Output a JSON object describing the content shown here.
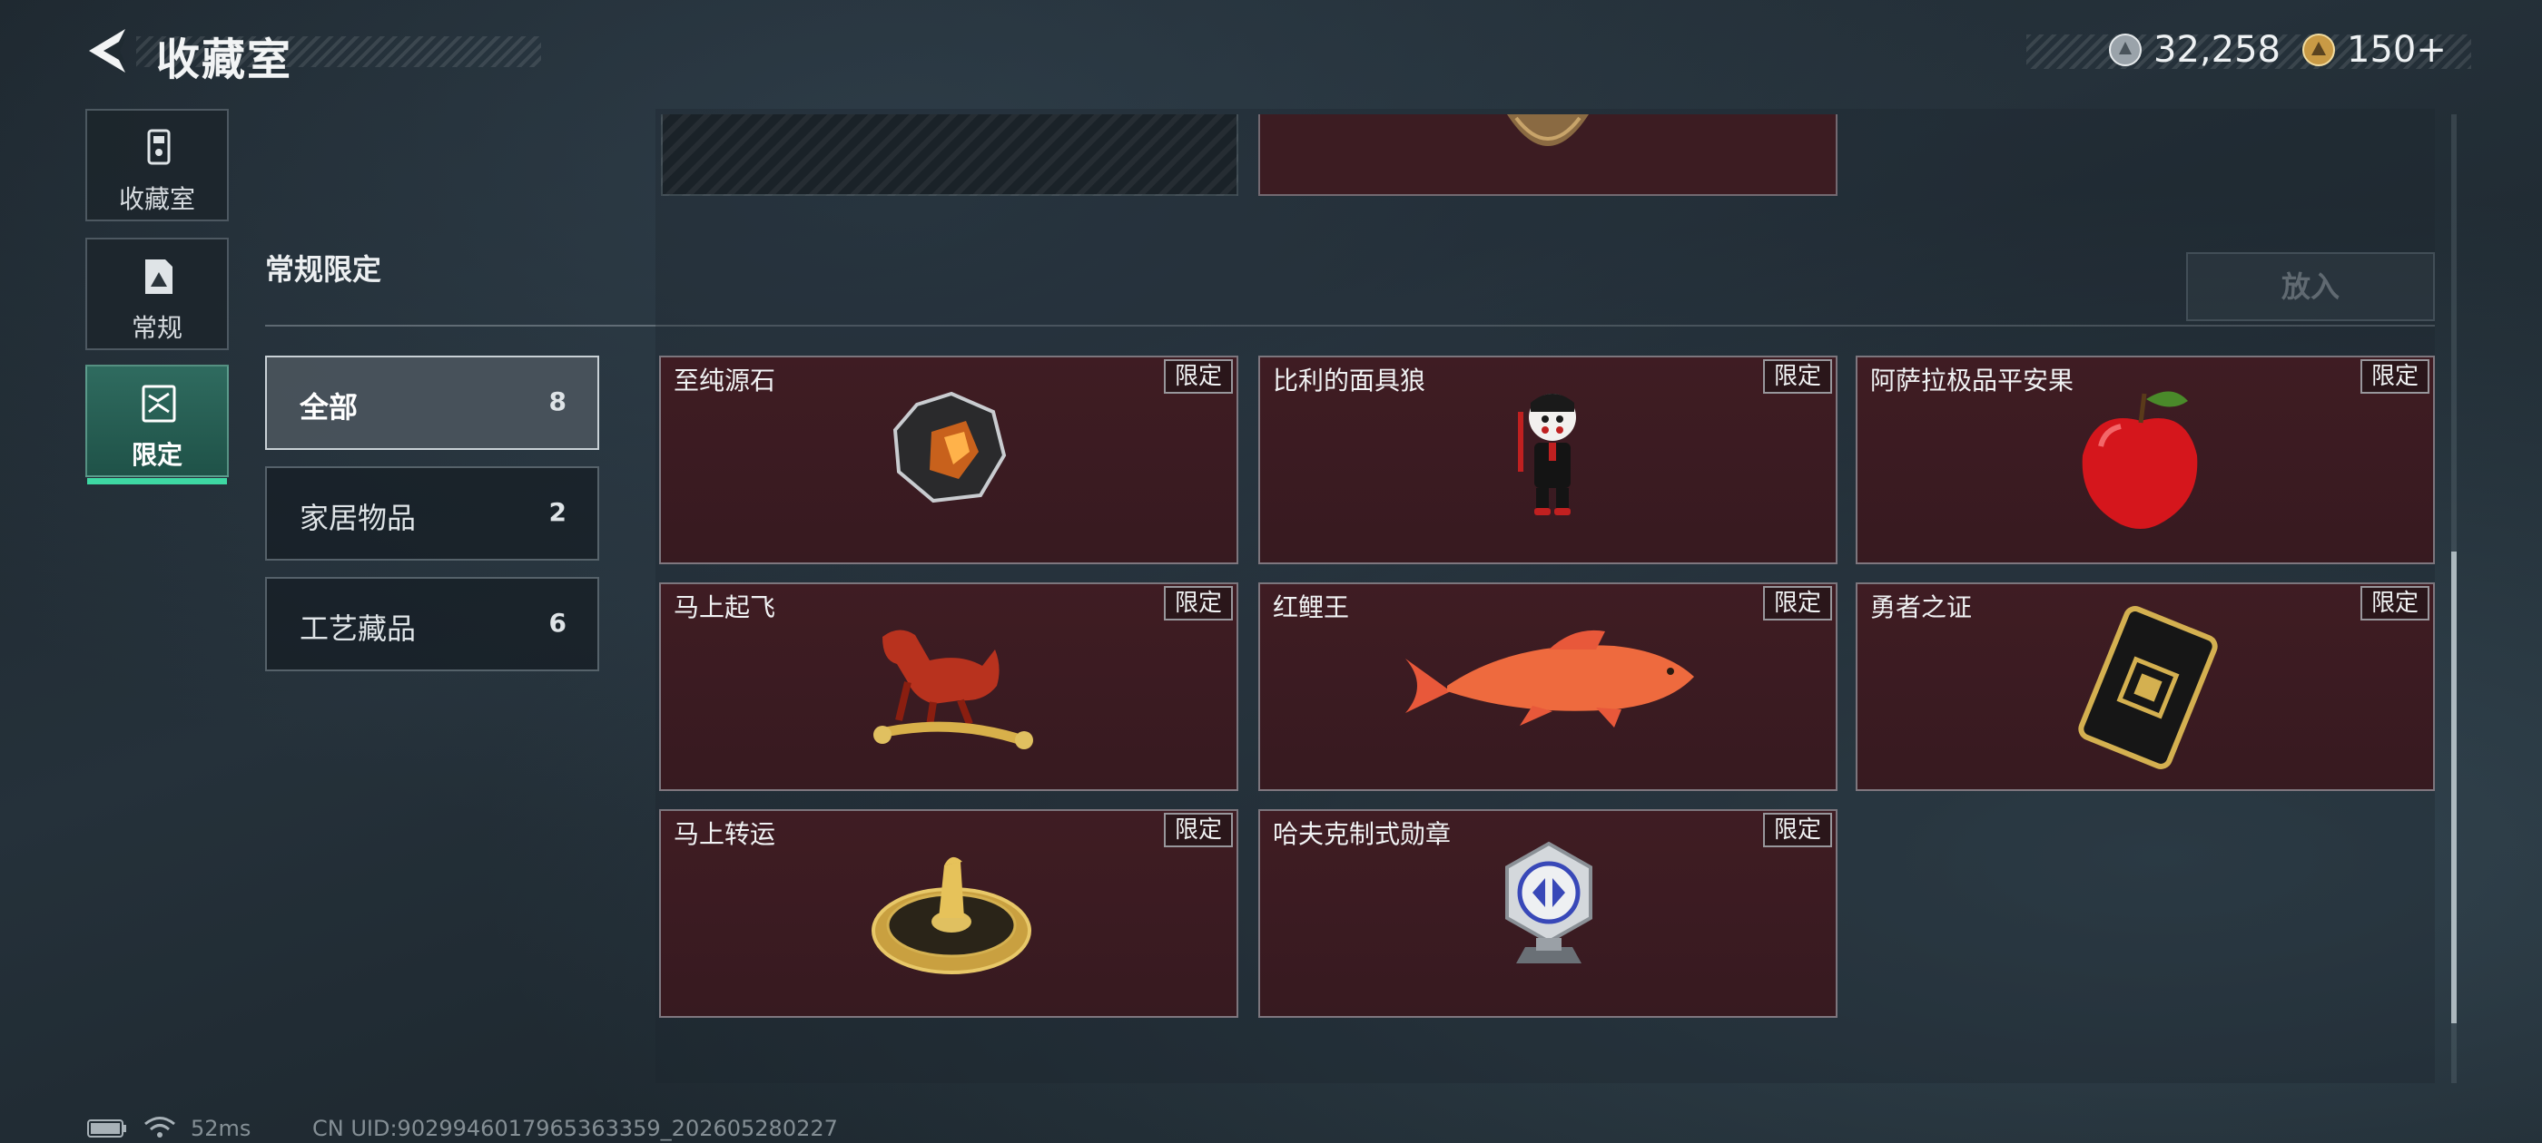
{
  "header": {
    "title": "收藏室",
    "currencies": [
      {
        "icon": "silver-coin-icon",
        "value": "32,258"
      },
      {
        "icon": "gold-coin-icon",
        "value": "150+"
      }
    ]
  },
  "nav": {
    "items": [
      {
        "label": "收藏室",
        "icon": "collection-icon",
        "active": false
      },
      {
        "label": "常规",
        "icon": "regular-icon",
        "active": false
      },
      {
        "label": "限定",
        "icon": "limited-icon",
        "active": true
      }
    ]
  },
  "section": {
    "title": "常规限定",
    "action_button": "放入"
  },
  "filters": [
    {
      "label": "全部",
      "count": "8",
      "active": true
    },
    {
      "label": "家居物品",
      "count": "2",
      "active": false
    },
    {
      "label": "工艺藏品",
      "count": "6",
      "active": false
    }
  ],
  "items": [
    {
      "name": "至纯源石",
      "badge": "限定",
      "icon": "crystal-stone-icon"
    },
    {
      "name": "比利的面具狼",
      "badge": "限定",
      "icon": "puppet-figure-icon"
    },
    {
      "name": "阿萨拉极品平安果",
      "badge": "限定",
      "icon": "red-apple-icon"
    },
    {
      "name": "马上起飞",
      "badge": "限定",
      "icon": "horse-statue-icon"
    },
    {
      "name": "红鲤王",
      "badge": "限定",
      "icon": "red-carp-icon"
    },
    {
      "name": "勇者之证",
      "badge": "限定",
      "icon": "black-card-icon"
    },
    {
      "name": "马上转运",
      "badge": "限定",
      "icon": "fortune-wheel-icon"
    },
    {
      "name": "哈夫克制式勋章",
      "badge": "限定",
      "icon": "medal-icon"
    }
  ],
  "status": {
    "ping": "52ms",
    "uid": "CN UID:9029946017965363359_202605280227"
  },
  "colors": {
    "accent": "#3ed8a3",
    "card_background": "#3c1c22",
    "active_nav": "#2f6b5f"
  }
}
